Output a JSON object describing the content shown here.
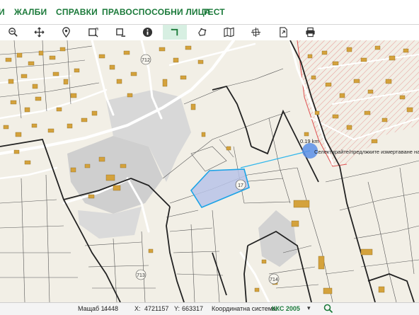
{
  "menu": {
    "items": [
      {
        "id": "first",
        "label": "И"
      },
      {
        "id": "complaints",
        "label": "ЖАЛБИ"
      },
      {
        "id": "references",
        "label": "СПРАВКИ"
      },
      {
        "id": "legal",
        "label": "ПРАВОСПОСОБНИ ЛИЦА"
      },
      {
        "id": "test",
        "label": "ТЕСТ"
      }
    ]
  },
  "toolbar": {
    "tools": [
      {
        "name": "zoom-out",
        "icon": "zoom-out-icon"
      },
      {
        "name": "pan",
        "icon": "move-icon"
      },
      {
        "name": "locate-point",
        "icon": "map-pin-icon"
      },
      {
        "name": "select-box",
        "icon": "select-box-icon"
      },
      {
        "name": "deselect-box",
        "icon": "deselect-box-icon"
      },
      {
        "name": "info",
        "icon": "info-icon"
      },
      {
        "name": "measure-area",
        "icon": "measure-icon",
        "active": true
      },
      {
        "name": "draw-shape",
        "icon": "polygon-icon"
      },
      {
        "name": "layers-map",
        "icon": "map-icon"
      },
      {
        "name": "coordinates",
        "icon": "crosshair-icon"
      },
      {
        "name": "export",
        "icon": "export-icon"
      },
      {
        "name": "print",
        "icon": "print-icon"
      }
    ]
  },
  "map": {
    "labels": {
      "parcel_17": "17",
      "parcel_712": "712",
      "parcel_713": "713",
      "parcel_714": "714"
    },
    "measure": {
      "distance": "0.19 km",
      "hint": "Селектирайте/предлжките измертаване на лин"
    },
    "colors": {
      "highlight_fill": "#b9c3e8",
      "highlight_stroke": "#1aa3e6",
      "measure_line": "#2fb6ec",
      "measure_point": "#5a8fe6",
      "building": "#d4a23c",
      "road": "#ffffff",
      "land": "#f2efe6",
      "shaded_area": "#cfcfcf",
      "boundary": "#222222",
      "hatch": "#e05252"
    }
  },
  "status": {
    "scale_label": "Мащаб 1:",
    "scale_value": "4448",
    "x_label": "X:",
    "x_value": "4721157",
    "y_label": "Y:",
    "y_value": "663317",
    "crs_label": "Координатна система:",
    "crs_value": "ККС 2005"
  }
}
